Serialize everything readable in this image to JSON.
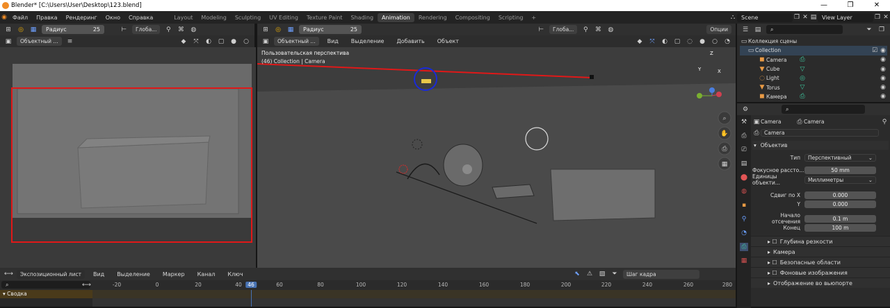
{
  "window": {
    "title": "Blender* [C:\\Users\\User\\Desktop\\123.blend]",
    "min": "—",
    "max": "❐",
    "close": "✕"
  },
  "menus": [
    "Файл",
    "Правка",
    "Рендеринг",
    "Окно",
    "Справка"
  ],
  "workspaces": [
    "Layout",
    "Modeling",
    "Sculpting",
    "UV Editing",
    "Texture Paint",
    "Shading",
    "Animation",
    "Rendering",
    "Compositing",
    "Scripting"
  ],
  "workspace_add": "+",
  "scene": {
    "value": "Scene"
  },
  "view_layer": {
    "value": "View Layer"
  },
  "left_header": {
    "radius_label": "Радиус",
    "radius_value": "25",
    "orient": "Глоба...",
    "mode": "Объектный ..."
  },
  "viewport": {
    "radius_label": "Радиус",
    "radius_value": "25",
    "orient": "Глоба...",
    "options": "Опции",
    "mode": "Объектный ...",
    "menu": [
      "Вид",
      "Выделение",
      "Добавить",
      "Объект"
    ],
    "perspective_label": "Пользовательская перспектива",
    "collection_label": "(46) Collection | Camera",
    "gizmo": {
      "x": "X",
      "y": "Y",
      "z": "Z"
    }
  },
  "outliner": {
    "scene_collection": "Коллекция сцены",
    "collection": "Collection",
    "items": [
      {
        "name": "Camera"
      },
      {
        "name": "Cube"
      },
      {
        "name": "Light"
      },
      {
        "name": "Torus"
      },
      {
        "name": "Камера"
      }
    ]
  },
  "properties": {
    "breadcrumb_a": "Camera",
    "breadcrumb_b": "Camera",
    "data_name": "Camera",
    "section": "Объектив",
    "type_label": "Тип",
    "type_value": "Перспективный",
    "focal_label": "Фокусное рассто...",
    "focal_value": "50 mm",
    "units_label": "Единицы объекти...",
    "units_value": "Миллиметры",
    "shift_x_label": "Сдвиг по X",
    "shift_x_value": "0.000",
    "shift_y_label": "Y",
    "shift_y_value": "0.000",
    "clip_start_label": "Начало отсечения",
    "clip_start_value": "0.1 m",
    "clip_end_label": "Конец",
    "clip_end_value": "100 m",
    "panels": [
      "Глубина резкости",
      "Камера",
      "Безопасные области",
      "Фоновые изображения",
      "Отображение во вьюпорте"
    ]
  },
  "timeline": {
    "editor": "Экспозиционный лист",
    "menu": [
      "Вид",
      "Выделение",
      "Маркер",
      "Канал",
      "Ключ"
    ],
    "snap": "Шаг кадра",
    "summary": "Сводка",
    "ticks": [
      "-20",
      "0",
      "20",
      "40",
      "46",
      "60",
      "80",
      "100",
      "120",
      "140",
      "160",
      "180",
      "200",
      "220",
      "240",
      "260",
      "280"
    ],
    "current_frame": 46
  },
  "colors": {
    "annotation_red": "#e01818",
    "annotation_blue": "#1a2ad8",
    "accent": "#4772b3"
  }
}
